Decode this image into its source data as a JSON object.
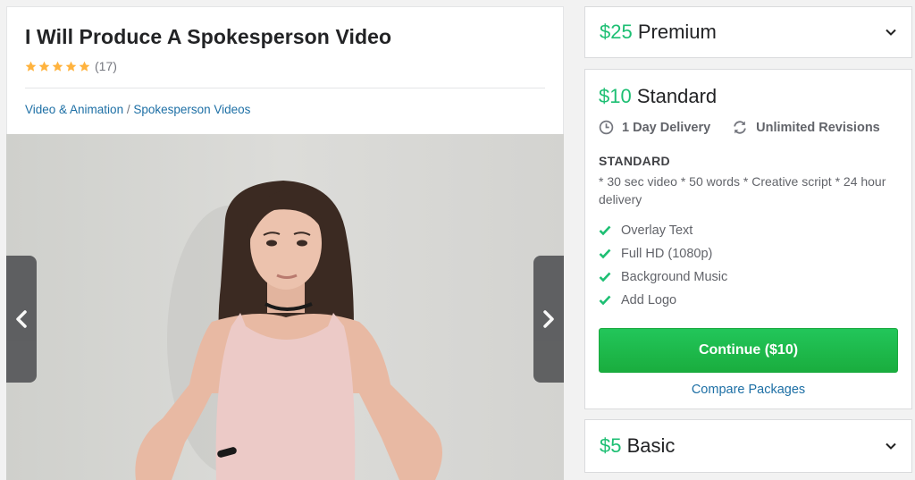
{
  "gig": {
    "title": "I Will Produce A Spokesperson Video",
    "rating_count": "(17)",
    "stars": 5,
    "star_color": "#ffb33e",
    "breadcrumb": {
      "category": "Video & Animation",
      "separator": " / ",
      "subcategory": "Spokesperson Videos"
    }
  },
  "media": {
    "prev_icon": "chevron-left-icon",
    "next_icon": "chevron-right-icon"
  },
  "packages": {
    "premium": {
      "price": "$25",
      "name": "Premium"
    },
    "standard": {
      "price": "$10",
      "name": "Standard",
      "delivery": "1 Day Delivery",
      "revisions": "Unlimited Revisions",
      "label": "STANDARD",
      "description": "* 30 sec video  * 50 words * Creative script  * 24 hour delivery",
      "features": [
        "Overlay Text",
        "Full HD (1080p)",
        "Background Music",
        "Add Logo"
      ],
      "continue_label": "Continue ($10)",
      "compare_label": "Compare Packages"
    },
    "basic": {
      "price": "$5",
      "name": "Basic"
    }
  },
  "colors": {
    "accent_green": "#1dbf73",
    "link_blue": "#1d6fa5"
  }
}
